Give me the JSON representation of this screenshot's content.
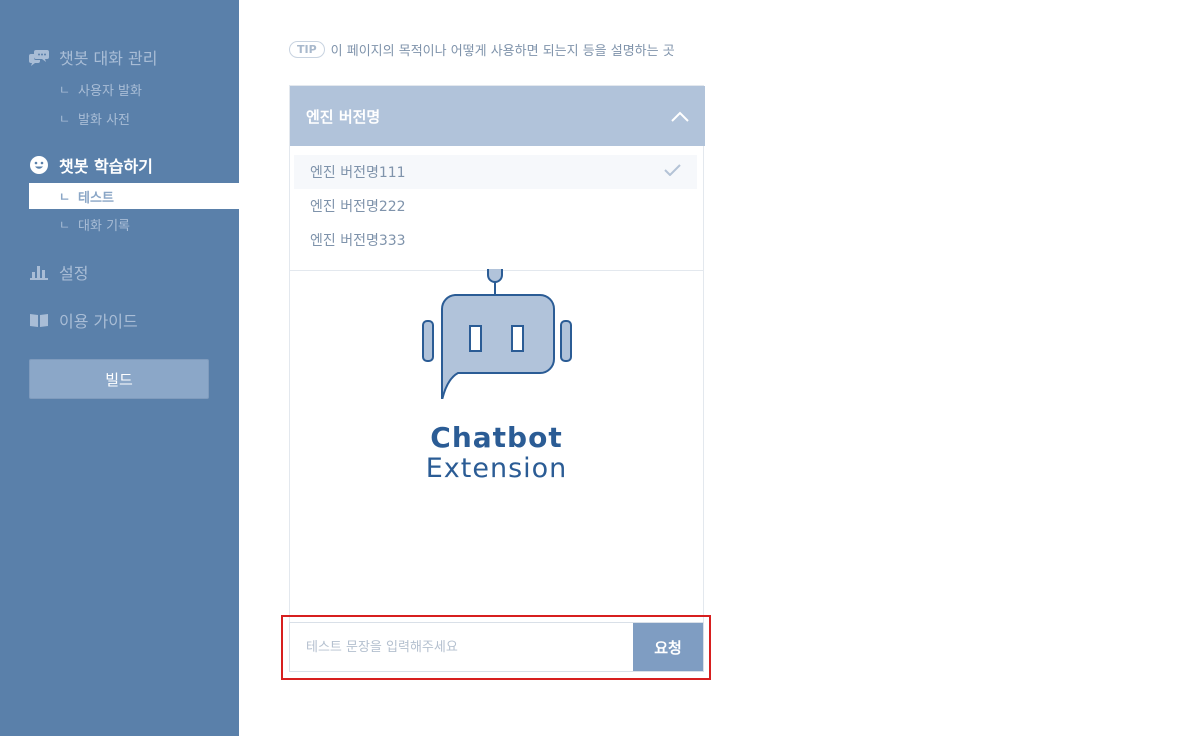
{
  "sidebar": {
    "chat_manage": {
      "label": "챗봇 대화 관리",
      "icon": "chat-bubbles-icon"
    },
    "chat_manage_items": [
      {
        "corner": "ㄴ",
        "label": "사용자 발화"
      },
      {
        "corner": "ㄴ",
        "label": "발화 사전"
      }
    ],
    "learn": {
      "label": "챗봇 학습하기",
      "icon": "smile-icon"
    },
    "learn_items": [
      {
        "corner": "ㄴ",
        "label": "테스트"
      },
      {
        "corner": "ㄴ",
        "label": "대화 기록"
      }
    ],
    "settings": {
      "label": "설정",
      "icon": "bar-chart-icon"
    },
    "guide": {
      "label": "이용 가이드",
      "icon": "book-icon"
    },
    "build_label": "빌드"
  },
  "tip": {
    "badge": "TIP",
    "text": "이 페이지의 목적이나 어떻게 사용하면 되는지 등을 설명하는 곳"
  },
  "engine_dropdown": {
    "title": "엔진 버전명",
    "options": [
      "엔진 버전명111",
      "엔진 버전명222",
      "엔진 버전명333"
    ],
    "selected_index": 0
  },
  "logo": {
    "line1": "Chatbot",
    "line2": "Extension"
  },
  "test_input": {
    "placeholder": "테스트 문장을 입력해주세요",
    "value": "",
    "button_label": "요청"
  },
  "colors": {
    "sidebar_bg": "#5a80aa",
    "dropdown_header": "#b1c3da",
    "request_button": "#7f9dc2",
    "highlight_border": "#d71f1f",
    "logo_text": "#2b5c95"
  }
}
